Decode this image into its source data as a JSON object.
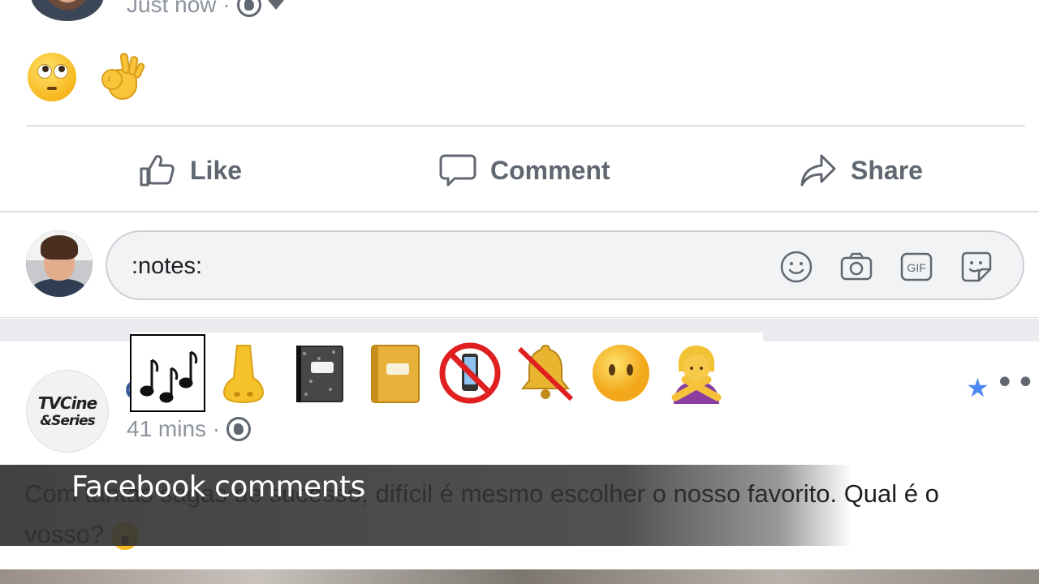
{
  "top_post": {
    "time": "Just now ·",
    "body_emojis": [
      "face-with-rolling-eyes",
      "ok-hand"
    ]
  },
  "actions": {
    "like": "Like",
    "comment": "Comment",
    "share": "Share"
  },
  "composer": {
    "value": ":notes:",
    "tools": [
      "smiley-icon",
      "camera-icon",
      "gif-icon",
      "sticker-icon"
    ],
    "gif_label": "GIF"
  },
  "emoji_suggestions": {
    "selected_index": 0,
    "items": [
      "musical-notes",
      "nose",
      "composition-notebook",
      "ledger-notebook",
      "no-mobile-phones",
      "bell-with-slash",
      "face-without-mouth",
      "person-gesturing-no"
    ]
  },
  "second_post": {
    "logo_line1": "TVCine",
    "logo_line2": "&Series",
    "name_fragment": "C",
    "time": "41 mins ·",
    "body": "Com tantas sagas de sucesso, difícil é mesmo escolher o nosso favorito. Qual é o vosso?"
  },
  "caption": "Facebook comments",
  "colors": {
    "link_blue": "#365899",
    "star_blue": "#4b88f0",
    "action_grey": "#606770"
  }
}
